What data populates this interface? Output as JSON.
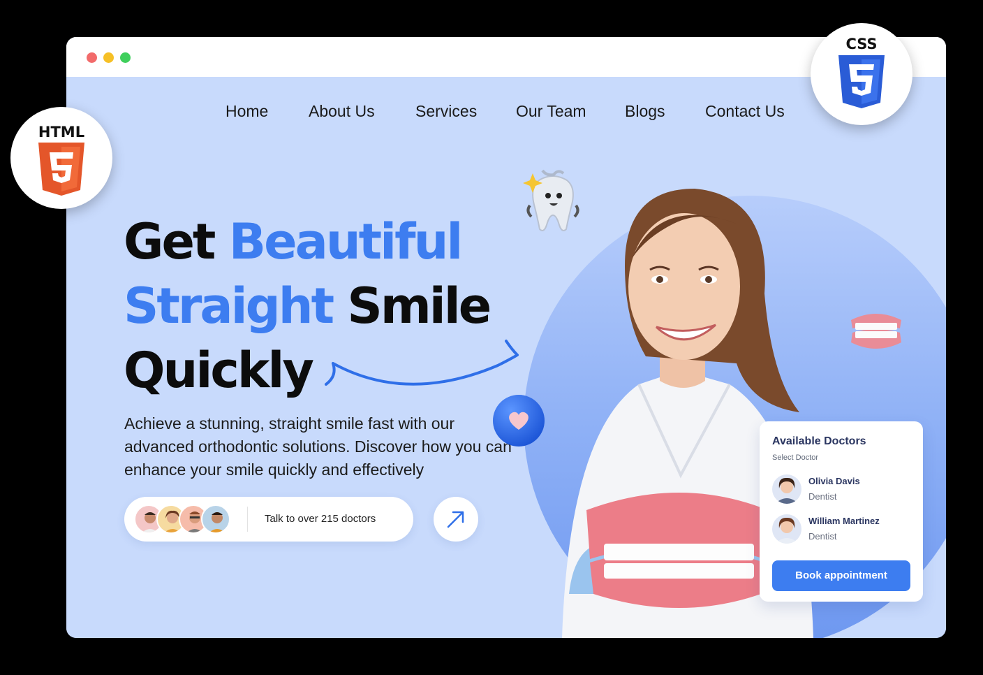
{
  "nav": {
    "items": [
      "Home",
      "About Us",
      "Services",
      "Our Team",
      "Blogs",
      "Contact Us"
    ]
  },
  "hero": {
    "line1_black": "Get",
    "line1_blue": "Beautiful",
    "line2_blue": "Straight",
    "line2_black": "Smile",
    "line3_black": "Quickly",
    "description": "Achieve a stunning, straight smile fast with our advanced orthodontic solutions. Discover how you can enhance your smile quickly and effectively",
    "doctors_pill_text": "Talk to over 215 doctors"
  },
  "card": {
    "title": "Available Doctors",
    "subtitle": "Select Doctor",
    "doctors": [
      {
        "name": "Olivia Davis",
        "role": "Dentist"
      },
      {
        "name": "William Martinez",
        "role": "Dentist"
      }
    ],
    "button_label": "Book appointment"
  },
  "badges": {
    "html_label": "HTML",
    "css_label": "CSS"
  },
  "colors": {
    "accent": "#3d7df0",
    "background": "#c8dafc",
    "html_orange": "#e4562a",
    "css_blue": "#2a5cd6"
  },
  "icons": [
    "arrow-up-right-icon",
    "heart-icon",
    "tooth-mascot-icon",
    "dentures-icon",
    "html5-icon",
    "css3-icon"
  ]
}
